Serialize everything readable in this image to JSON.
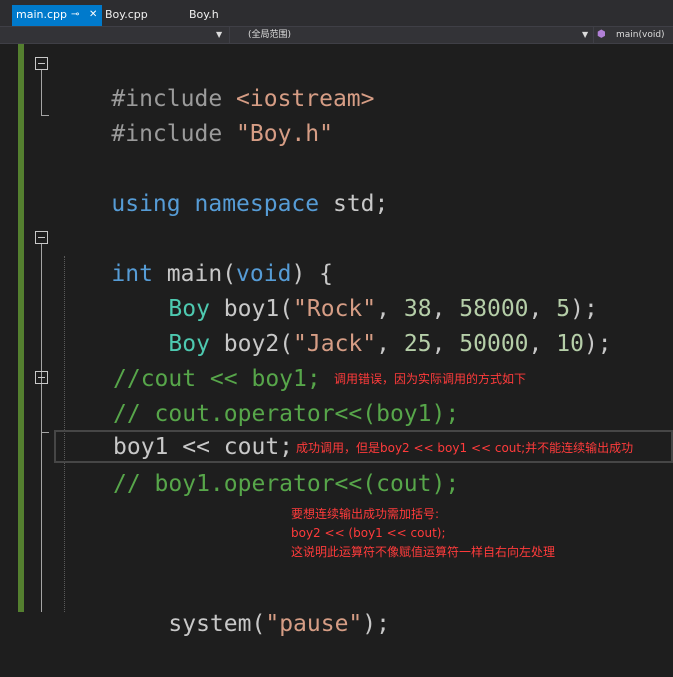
{
  "tabs": [
    {
      "label": "main.cpp",
      "active": true
    },
    {
      "label": "Boy.cpp",
      "active": false
    },
    {
      "label": "Boy.h",
      "active": false
    }
  ],
  "navbar": {
    "scope": "(全局范围)",
    "member": "main(void)"
  },
  "code": {
    "line1": {
      "directive": "#include",
      "header": "<iostream>"
    },
    "line2": {
      "directive": "#include",
      "header": "\"Boy.h\""
    },
    "line3": {
      "kw1": "using",
      "kw2": "namespace",
      "rest": "std;"
    },
    "line4": {
      "ret": "int",
      "name": "main",
      "lp": "(",
      "param": "void",
      "rp": ")",
      "brace": "{"
    },
    "line5": {
      "type": "Boy",
      "var": "boy1",
      "lp": "(",
      "str": "\"Rock\"",
      "c1": ",",
      "n1": "38",
      "c2": ",",
      "n2": "58000",
      "c3": ",",
      "n3": "5",
      "end": ");"
    },
    "line6": {
      "type": "Boy",
      "var": "boy2",
      "lp": "(",
      "str": "\"Jack\"",
      "c1": ",",
      "n1": "25",
      "c2": ",",
      "n2": "50000",
      "c3": ",",
      "n3": "10",
      "end": ");"
    },
    "line7": {
      "comment": "//cout << boy1;"
    },
    "line8": {
      "comment": "// cout.operator<<(boy1);"
    },
    "line9": {
      "text": "boy1 << cout;"
    },
    "line10": {
      "comment": "// boy1.operator<<(cout);"
    },
    "line11": {
      "fn": "system",
      "lp": "(",
      "str": "\"pause\"",
      "end": ");"
    }
  },
  "annotations": {
    "note1": "调用错误，因为实际调用的方式如下",
    "note2": "成功调用，但是boy2 << boy1 << cout;并不能连续输出成功",
    "note3_line1": "要想连续输出成功需加括号:",
    "note3_line2": "boy2 << (boy1 << cout);",
    "note3_line3": "这说明此运算符不像赋值运算符一样自右向左处理"
  },
  "colors": {
    "active_tab": "#007acc",
    "keyword": "#569cd6",
    "type": "#4ec9b0",
    "string": "#d69d85",
    "number": "#b5cea8",
    "comment": "#57a64a",
    "annotation": "#ff3b3b",
    "changed_bar": "#547f2f"
  }
}
